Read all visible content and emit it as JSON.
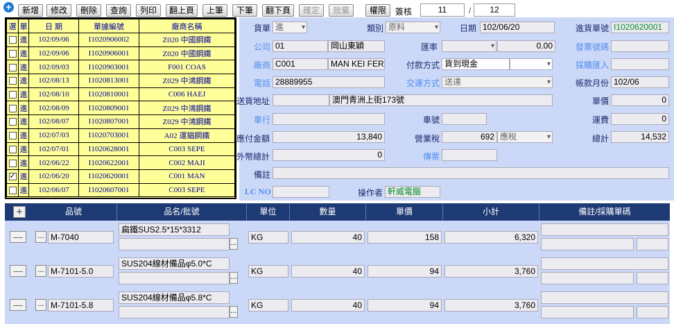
{
  "toolbar": {
    "buttons": [
      "新增",
      "修改",
      "刪除",
      "查詢",
      "列印",
      "翻上頁",
      "上筆",
      "下筆",
      "翻下頁",
      "確定",
      "放棄",
      "權限"
    ],
    "sign_label": "簽核",
    "page_current": "11",
    "page_sep": "/",
    "page_total": "12"
  },
  "list": {
    "headers": [
      "選",
      "單",
      "日 期",
      "單據編號",
      "廠商名稱"
    ],
    "rows": [
      {
        "checked": false,
        "type": "進",
        "date": "102/09/06",
        "no": "I1020906002",
        "vendor": "Z020 中國鋼鐵"
      },
      {
        "checked": false,
        "type": "進",
        "date": "102/09/06",
        "no": "I1020906001",
        "vendor": "Z020 中國鋼鐵"
      },
      {
        "checked": false,
        "type": "進",
        "date": "102/09/03",
        "no": "I1020903001",
        "vendor": "F001 COAS"
      },
      {
        "checked": false,
        "type": "進",
        "date": "102/08/13",
        "no": "I1020813001",
        "vendor": "Z029 中鴻鋼鐵"
      },
      {
        "checked": false,
        "type": "進",
        "date": "102/08/10",
        "no": "I1020810001",
        "vendor": "C006 HAEJ"
      },
      {
        "checked": false,
        "type": "進",
        "date": "102/08/09",
        "no": "I1020809001",
        "vendor": "Z029 中鴻鋼鐵"
      },
      {
        "checked": false,
        "type": "進",
        "date": "102/08/07",
        "no": "I1020807001",
        "vendor": "Z029 中鴻鋼鐵"
      },
      {
        "checked": false,
        "type": "進",
        "date": "102/07/03",
        "no": "I1020703001",
        "vendor": "A02 運錩鋼鐵"
      },
      {
        "checked": false,
        "type": "進",
        "date": "102/07/01",
        "no": "I1020628001",
        "vendor": "C003 SEPE"
      },
      {
        "checked": false,
        "type": "進",
        "date": "102/06/22",
        "no": "I1020622001",
        "vendor": "C002 MAJI"
      },
      {
        "checked": true,
        "type": "進",
        "date": "102/06/20",
        "no": "I1020620001",
        "vendor": "C001 MAN"
      },
      {
        "checked": false,
        "type": "進",
        "date": "102/06/07",
        "no": "I1020607001",
        "vendor": "C003 SEPE"
      }
    ]
  },
  "form": {
    "doc_type_label": "貨單",
    "doc_type": "進",
    "category_label": "類別",
    "category": "原料",
    "date_label": "日期",
    "date": "102/06/20",
    "order_no_label": "進貨單號",
    "order_no": "I1020620001",
    "company_label": "公司",
    "company_code": "01",
    "company_name": "岡山東穎",
    "rate_label": "匯率",
    "rate": "0.00",
    "invoice_no_label": "發票號碼",
    "invoice_no": "",
    "vendor_label": "廠商",
    "vendor_code": "C001",
    "vendor_name": "MAN KEI FERF",
    "payment_label": "付款方式",
    "payment": "貨到現金",
    "payment_extra": "",
    "purchase_import_label": "採購匯入",
    "purchase_import": "",
    "phone_label": "電話",
    "phone": "28889955",
    "delivery_label": "交運方式",
    "delivery": "送達",
    "account_month_label": "帳款月份",
    "account_month": "102/06",
    "address_label": "送貨地址",
    "address": "澳門青洲上街173號",
    "unit_price_label": "單價",
    "unit_price": "0",
    "vehicle_label": "車行",
    "vehicle": "",
    "plate_label": "車號",
    "plate": "",
    "freight_label": "運費",
    "freight": "0",
    "payable_label": "應付金額",
    "payable": "13,840",
    "tax_label": "營業稅",
    "tax": "692",
    "tax_type": "應稅",
    "total_label": "總計",
    "total": "14,532",
    "foreign_total_label": "外幣總計",
    "foreign_total": "0",
    "voucher_label": "傳票",
    "voucher": "",
    "note_label": "備註",
    "note": "",
    "lc_label": "LC NO",
    "lc": "",
    "operator_label": "操作者",
    "operator": "軒威電腦"
  },
  "grid": {
    "add_symbol": "+",
    "headers": [
      "品號",
      "品名/批號",
      "單位",
      "數量",
      "單價",
      "小計",
      "備註/採購單碼"
    ],
    "rows": [
      {
        "item_no": "M-7040",
        "name": "扁鐵SUS2.5*15*3312",
        "unit": "KG",
        "qty": "40",
        "price": "158",
        "subtotal": "6,320"
      },
      {
        "item_no": "M-7101-5.0",
        "name": "SUS204線材備品φ5.0*C",
        "unit": "KG",
        "qty": "40",
        "price": "94",
        "subtotal": "3,760"
      },
      {
        "item_no": "M-7101-5.8",
        "name": "SUS204線材備品φ5.8*C",
        "unit": "KG",
        "qty": "40",
        "price": "94",
        "subtotal": "3,760"
      }
    ],
    "minus_symbol": "—",
    "dots_symbol": "..."
  }
}
